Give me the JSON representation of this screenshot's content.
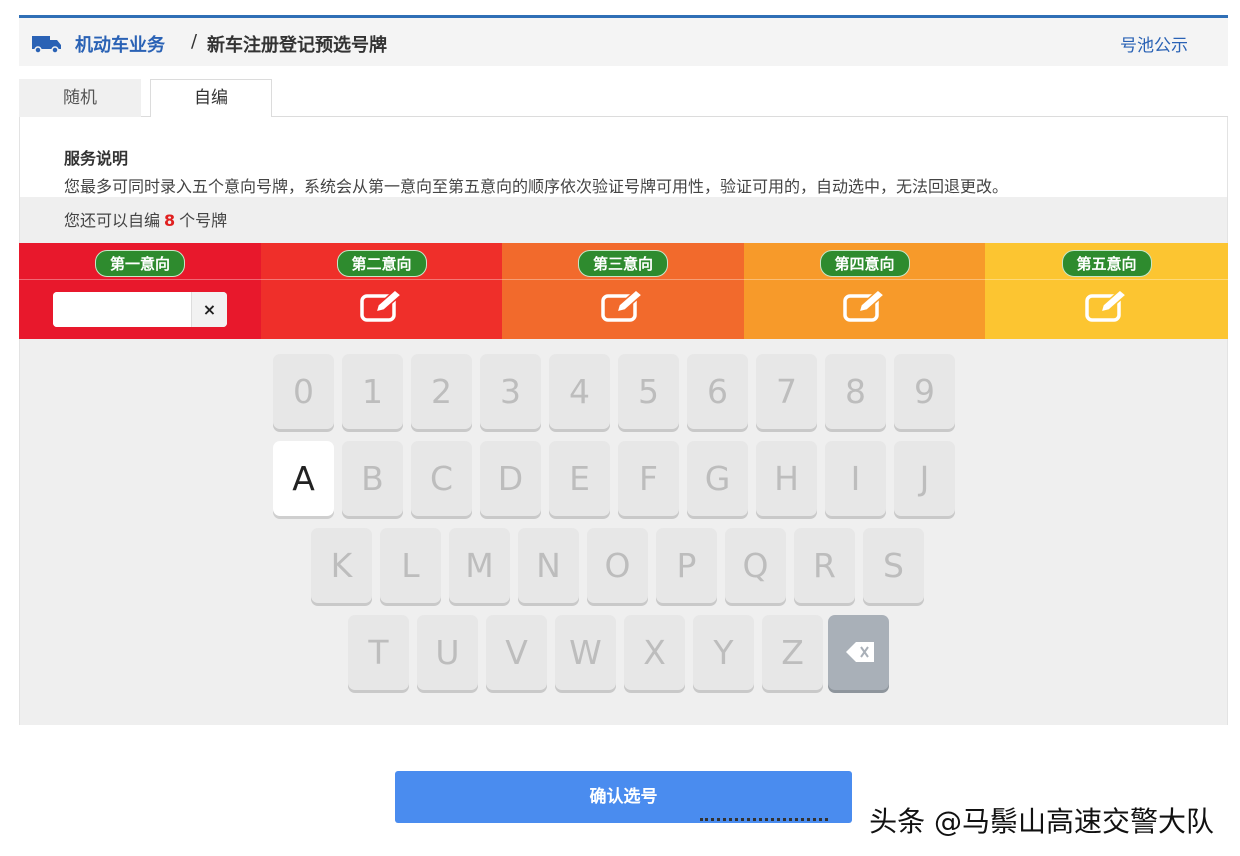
{
  "header": {
    "breadcrumb_main": "机动车业务",
    "breadcrumb_sep": "/",
    "breadcrumb_sub": "新车注册登记预选号牌",
    "pool_link": "号池公示"
  },
  "tabs": [
    {
      "label": "随机",
      "active": false
    },
    {
      "label": "自编",
      "active": true
    }
  ],
  "service": {
    "title": "服务说明",
    "description": "您最多可同时录入五个意向号牌，系统会从第一意向至第五意向的顺序依次验证号牌可用性，验证可用的，自动选中，无法回退更改。",
    "remain_prefix": "您还可以自编",
    "remain_count": "8",
    "remain_suffix": "个号牌"
  },
  "preferences": [
    {
      "label": "第一意向",
      "color": "#e8182c",
      "input_value": "",
      "clear_label": "×"
    },
    {
      "label": "第二意向",
      "color": "#ef2f2a"
    },
    {
      "label": "第三意向",
      "color": "#f26a2c"
    },
    {
      "label": "第四意向",
      "color": "#f79a2a"
    },
    {
      "label": "第五意向",
      "color": "#fcc531"
    }
  ],
  "keyboard": {
    "row1": [
      "0",
      "1",
      "2",
      "3",
      "4",
      "5",
      "6",
      "7",
      "8",
      "9"
    ],
    "row2": [
      "A",
      "B",
      "C",
      "D",
      "E",
      "F",
      "G",
      "H",
      "I",
      "J"
    ],
    "row3": [
      "K",
      "L",
      "M",
      "N",
      "O",
      "P",
      "Q",
      "R",
      "S"
    ],
    "row4": [
      "T",
      "U",
      "V",
      "W",
      "X",
      "Y",
      "Z"
    ],
    "active_key": "A",
    "backspace_icon": "backspace-icon"
  },
  "confirm_label": "确认选号",
  "watermark": "头条 @马鬃山高速交警大队",
  "colors": {
    "brand_blue": "#2a62b5",
    "confirm_blue": "#4a8cef",
    "badge_green": "#2e8b2e"
  }
}
